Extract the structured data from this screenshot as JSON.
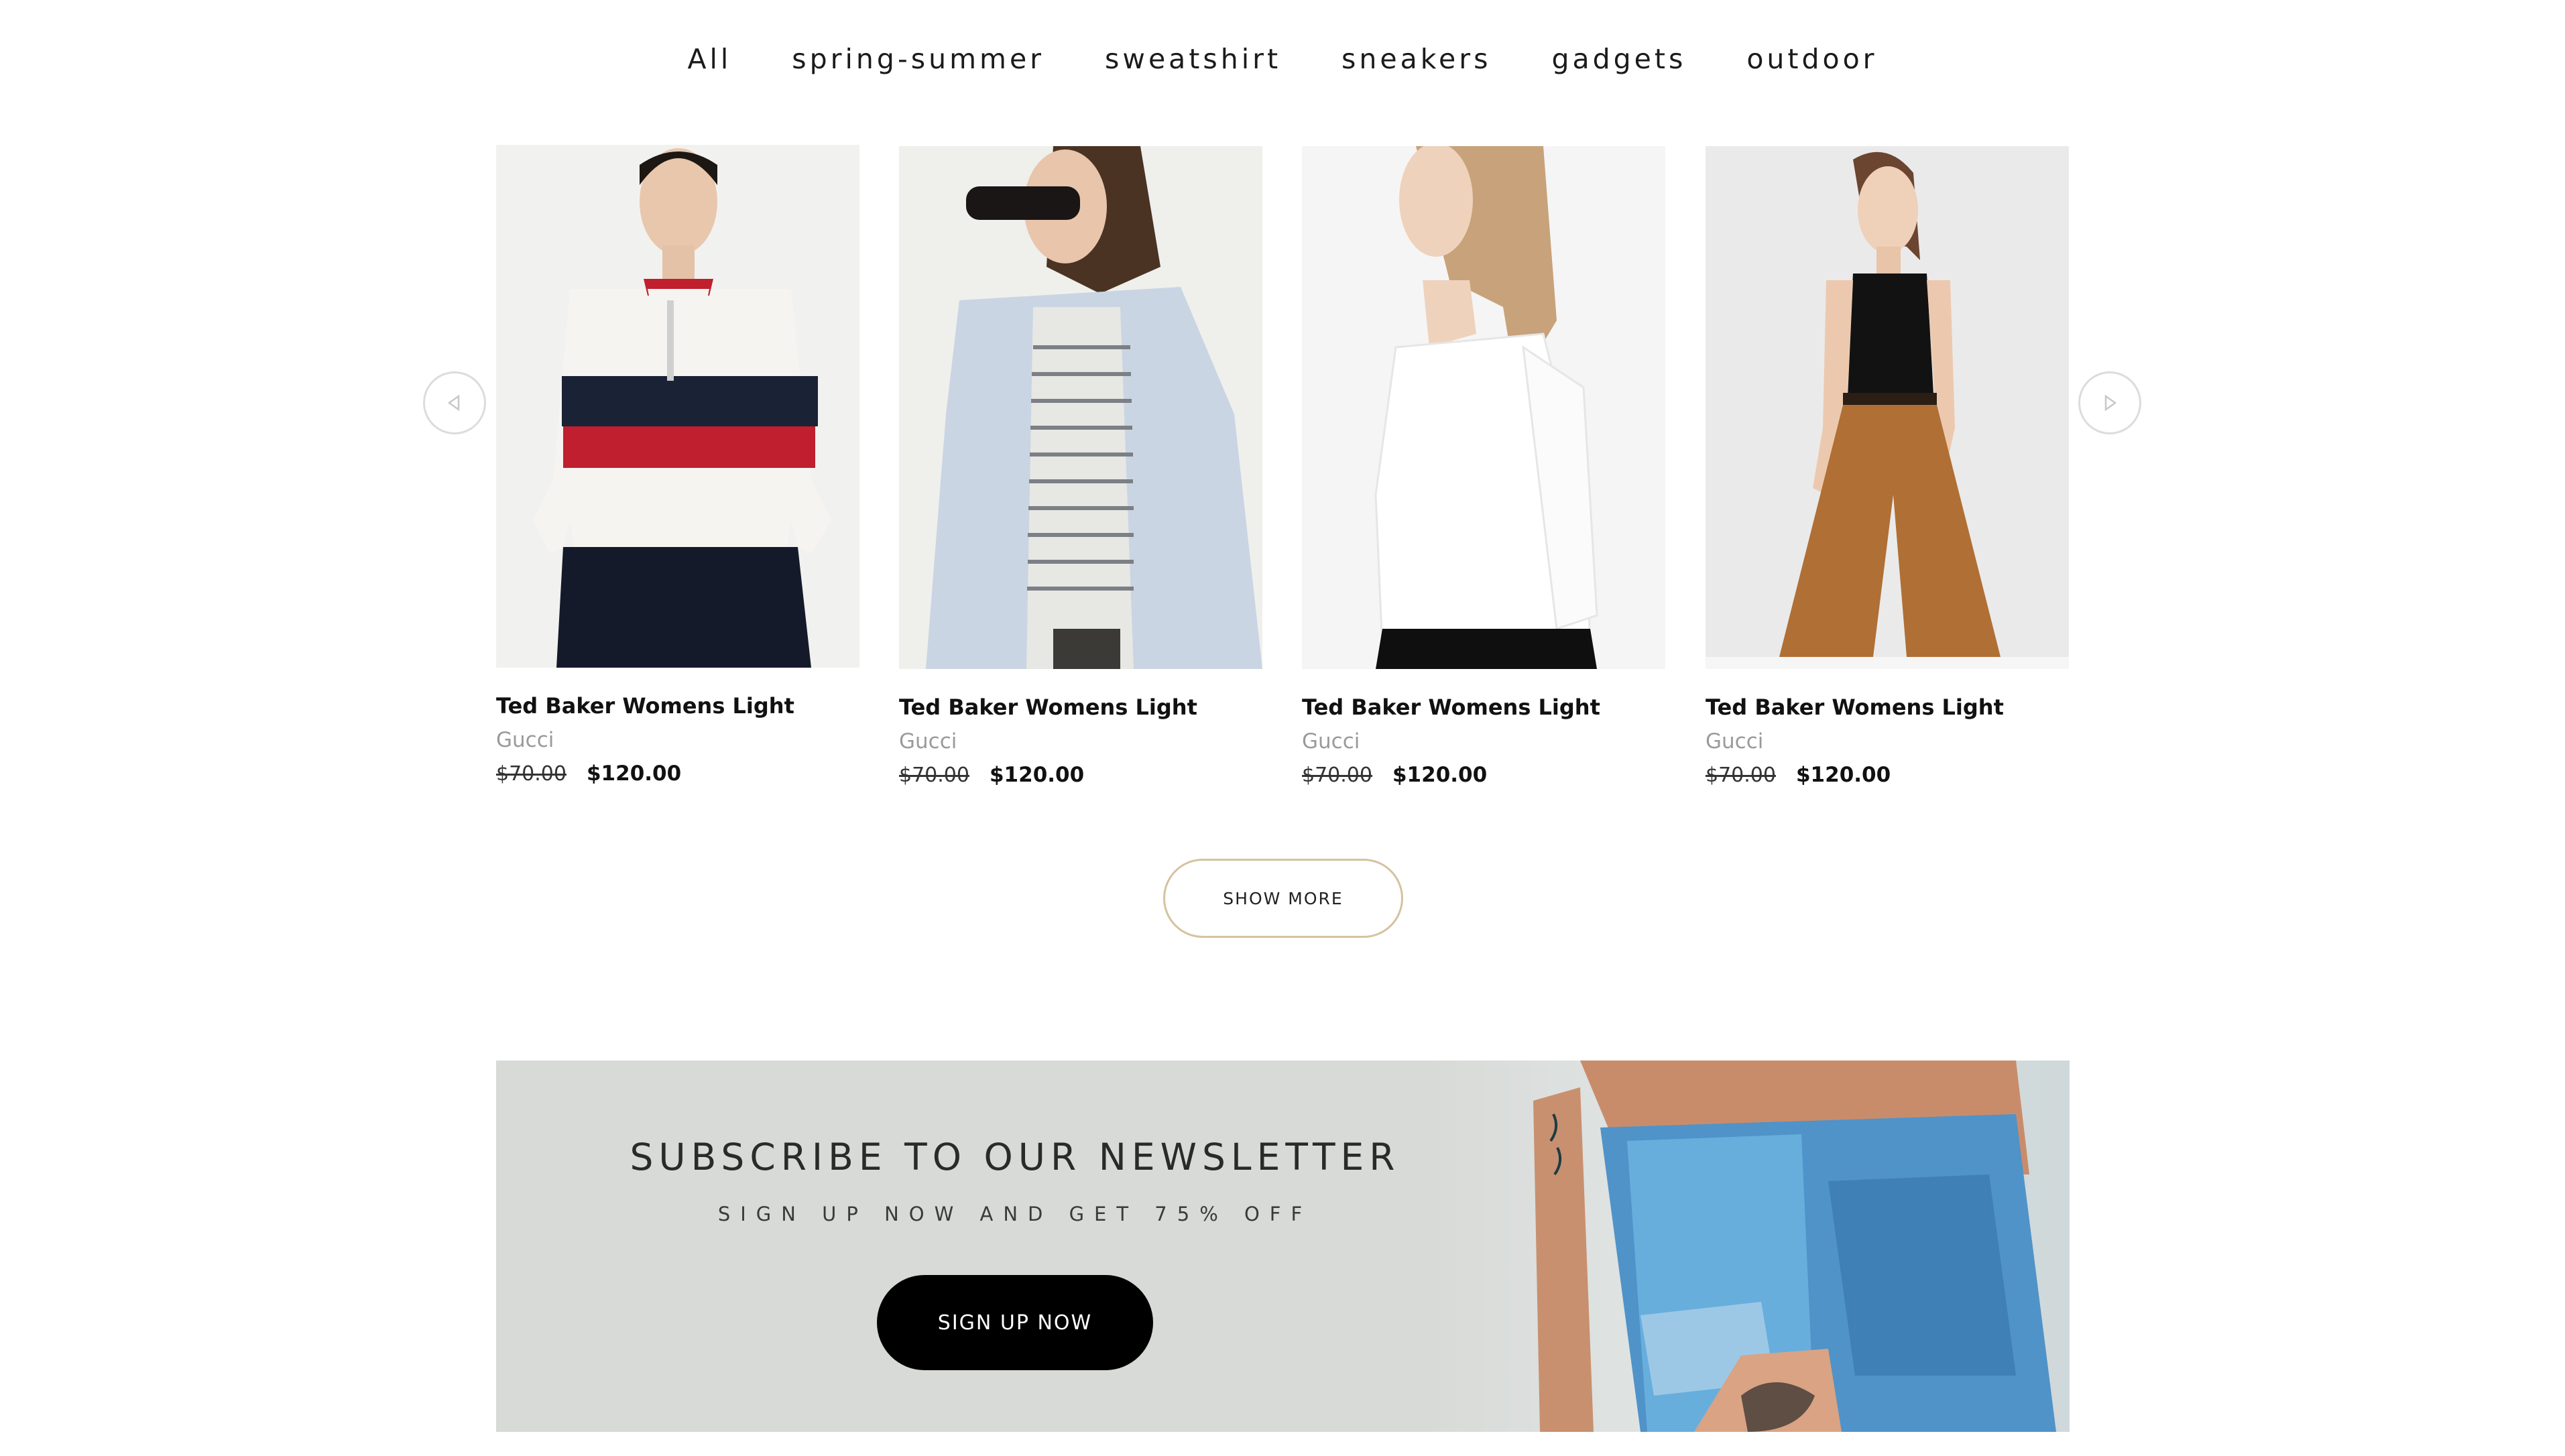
{
  "tabs": [
    {
      "label": "All"
    },
    {
      "label": "spring-summer"
    },
    {
      "label": "sweatshirt"
    },
    {
      "label": "sneakers"
    },
    {
      "label": "gadgets"
    },
    {
      "label": "outdoor"
    }
  ],
  "carousel": {
    "prev_icon": "chevron-left-icon",
    "next_icon": "chevron-right-icon",
    "products": [
      {
        "name": "Ted Baker Womens Light",
        "brand": "Gucci",
        "old_price": "$70.00",
        "price": "$120.00"
      },
      {
        "name": "Ted Baker Womens Light",
        "brand": "Gucci",
        "old_price": "$70.00",
        "price": "$120.00"
      },
      {
        "name": "Ted Baker Womens Light",
        "brand": "Gucci",
        "old_price": "$70.00",
        "price": "$120.00"
      },
      {
        "name": "Ted Baker Womens Light",
        "brand": "Gucci",
        "old_price": "$70.00",
        "price": "$120.00"
      }
    ]
  },
  "show_more": {
    "label": "SHOW MORE",
    "border_color": "#d5c2a0"
  },
  "newsletter": {
    "title": "SUBSCRIBE TO OUR NEWSLETTER",
    "subtitle": "SIGN UP NOW AND GET 75% OFF",
    "button_label": "SIGN UP NOW",
    "background_color": "#d8dad7"
  }
}
